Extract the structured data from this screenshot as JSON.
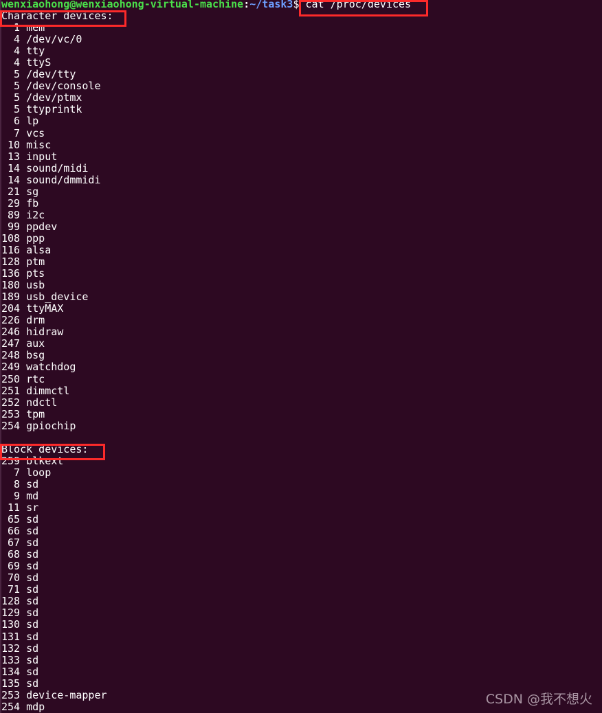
{
  "terminal": {
    "background_color": "#2d0922",
    "foreground_color": "#ffffff",
    "annotation_color": "#fc2a2a",
    "prompt": {
      "user_host": "wenxiaohong@wenxiaohong-virtual-machine",
      "separator": ":",
      "path": "~/task3",
      "sigil": "$",
      "command": "cat /proc/devices",
      "user_host_color": "#4ae04a",
      "path_color": "#6d9eff"
    },
    "sections": [
      {
        "header": "Character devices:",
        "devices": [
          {
            "major": "1",
            "name": "mem"
          },
          {
            "major": "4",
            "name": "/dev/vc/0"
          },
          {
            "major": "4",
            "name": "tty"
          },
          {
            "major": "4",
            "name": "ttyS"
          },
          {
            "major": "5",
            "name": "/dev/tty"
          },
          {
            "major": "5",
            "name": "/dev/console"
          },
          {
            "major": "5",
            "name": "/dev/ptmx"
          },
          {
            "major": "5",
            "name": "ttyprintk"
          },
          {
            "major": "6",
            "name": "lp"
          },
          {
            "major": "7",
            "name": "vcs"
          },
          {
            "major": "10",
            "name": "misc"
          },
          {
            "major": "13",
            "name": "input"
          },
          {
            "major": "14",
            "name": "sound/midi"
          },
          {
            "major": "14",
            "name": "sound/dmmidi"
          },
          {
            "major": "21",
            "name": "sg"
          },
          {
            "major": "29",
            "name": "fb"
          },
          {
            "major": "89",
            "name": "i2c"
          },
          {
            "major": "99",
            "name": "ppdev"
          },
          {
            "major": "108",
            "name": "ppp"
          },
          {
            "major": "116",
            "name": "alsa"
          },
          {
            "major": "128",
            "name": "ptm"
          },
          {
            "major": "136",
            "name": "pts"
          },
          {
            "major": "180",
            "name": "usb"
          },
          {
            "major": "189",
            "name": "usb_device"
          },
          {
            "major": "204",
            "name": "ttyMAX"
          },
          {
            "major": "226",
            "name": "drm"
          },
          {
            "major": "246",
            "name": "hidraw"
          },
          {
            "major": "247",
            "name": "aux"
          },
          {
            "major": "248",
            "name": "bsg"
          },
          {
            "major": "249",
            "name": "watchdog"
          },
          {
            "major": "250",
            "name": "rtc"
          },
          {
            "major": "251",
            "name": "dimmctl"
          },
          {
            "major": "252",
            "name": "ndctl"
          },
          {
            "major": "253",
            "name": "tpm"
          },
          {
            "major": "254",
            "name": "gpiochip"
          }
        ]
      },
      {
        "header": "Block devices:",
        "devices": [
          {
            "major": "259",
            "name": "blkext"
          },
          {
            "major": "7",
            "name": "loop"
          },
          {
            "major": "8",
            "name": "sd"
          },
          {
            "major": "9",
            "name": "md"
          },
          {
            "major": "11",
            "name": "sr"
          },
          {
            "major": "65",
            "name": "sd"
          },
          {
            "major": "66",
            "name": "sd"
          },
          {
            "major": "67",
            "name": "sd"
          },
          {
            "major": "68",
            "name": "sd"
          },
          {
            "major": "69",
            "name": "sd"
          },
          {
            "major": "70",
            "name": "sd"
          },
          {
            "major": "71",
            "name": "sd"
          },
          {
            "major": "128",
            "name": "sd"
          },
          {
            "major": "129",
            "name": "sd"
          },
          {
            "major": "130",
            "name": "sd"
          },
          {
            "major": "131",
            "name": "sd"
          },
          {
            "major": "132",
            "name": "sd"
          },
          {
            "major": "133",
            "name": "sd"
          },
          {
            "major": "134",
            "name": "sd"
          },
          {
            "major": "135",
            "name": "sd"
          },
          {
            "major": "253",
            "name": "device-mapper"
          },
          {
            "major": "254",
            "name": "mdp"
          }
        ]
      }
    ],
    "watermark": "CSDN @我不想火"
  }
}
